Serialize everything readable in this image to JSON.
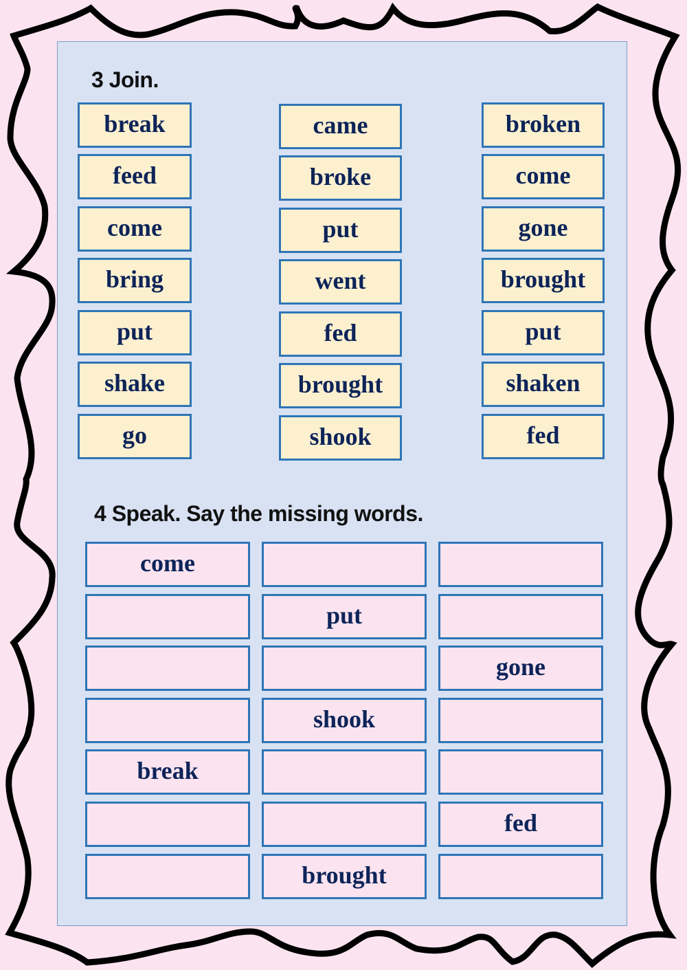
{
  "colors": {
    "page_background": "#fbe4ef",
    "panel_background": "#d9e2f3",
    "box_border": "#2e75b6",
    "word_box_fill": "#fdf0cf",
    "grid_cell_fill": "#fbe4ef",
    "word_text": "#0d2459",
    "heading_text": "#111111"
  },
  "exercise3": {
    "heading": "3 Join.",
    "columns": [
      [
        "break",
        "feed",
        "come",
        "bring",
        "put",
        "shake",
        "go"
      ],
      [
        "came",
        "broke",
        "put",
        "went",
        "fed",
        "brought",
        "shook"
      ],
      [
        "broken",
        "come",
        "gone",
        "brought",
        "put",
        "shaken",
        "fed"
      ]
    ]
  },
  "exercise4": {
    "heading": "4 Speak. Say the missing words.",
    "rows": [
      [
        "come",
        "",
        ""
      ],
      [
        "",
        "put",
        ""
      ],
      [
        "",
        "",
        "gone"
      ],
      [
        "",
        "shook",
        ""
      ],
      [
        "break",
        "",
        ""
      ],
      [
        "",
        "",
        "fed"
      ],
      [
        "",
        "brought",
        ""
      ]
    ]
  }
}
